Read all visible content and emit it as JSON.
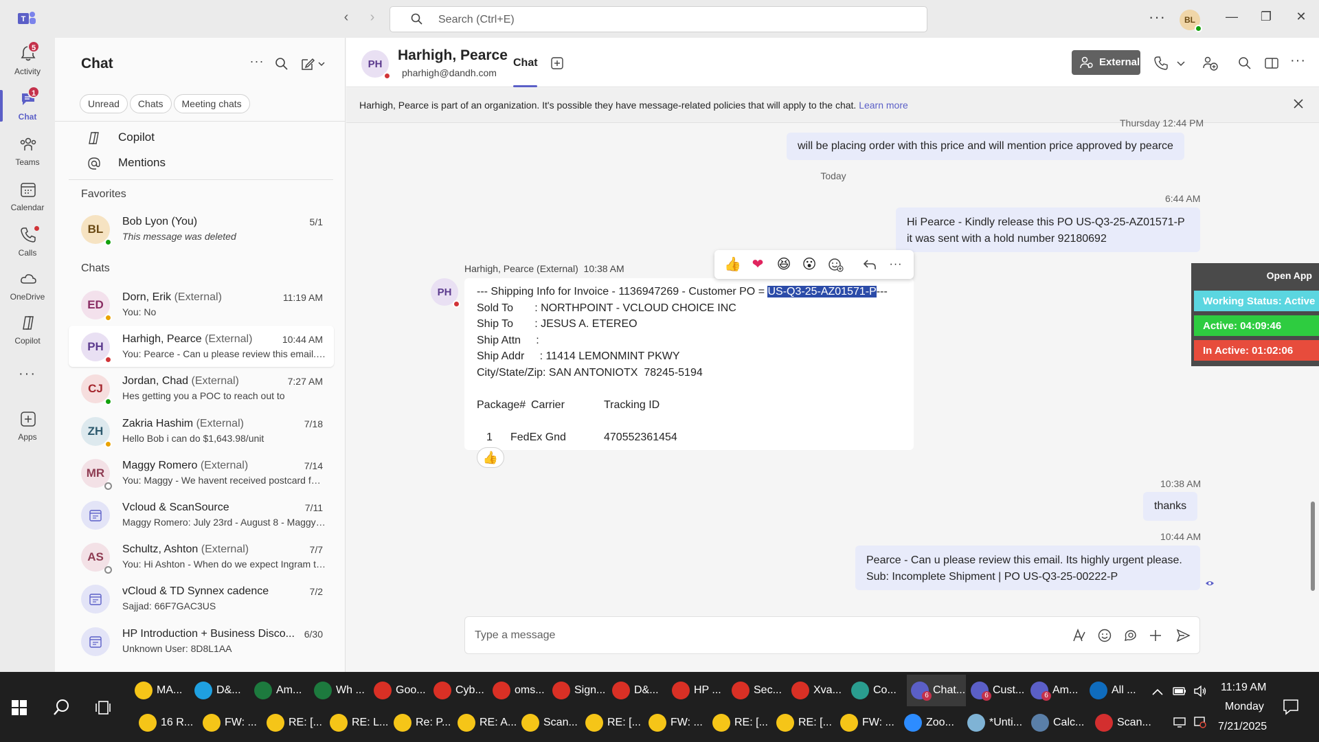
{
  "titlebar": {
    "search_placeholder": "Search (Ctrl+E)",
    "user_initials": "BL",
    "more": "···"
  },
  "rail": [
    {
      "label": "Activity",
      "icon": "bell-icon",
      "badge": "5"
    },
    {
      "label": "Chat",
      "icon": "chat-icon",
      "badge": "1",
      "active": true
    },
    {
      "label": "Teams",
      "icon": "teams-icon"
    },
    {
      "label": "Calendar",
      "icon": "calendar-icon"
    },
    {
      "label": "Calls",
      "icon": "phone-icon"
    },
    {
      "label": "OneDrive",
      "icon": "cloud-icon"
    },
    {
      "label": "Copilot",
      "icon": "copilot-icon"
    },
    {
      "label": "Apps",
      "icon": "apps-icon"
    }
  ],
  "chat_panel": {
    "title": "Chat",
    "filters": [
      "Unread",
      "Chats",
      "Meeting chats"
    ],
    "links": [
      {
        "label": "Copilot",
        "icon": "copilot-icon"
      },
      {
        "label": "Mentions",
        "icon": "at-icon"
      }
    ],
    "favorites_label": "Favorites",
    "favorites": [
      {
        "initials": "BL",
        "name": "Bob Lyon (You)",
        "ext": "",
        "time": "5/1",
        "preview": "This message was deleted",
        "italic": true,
        "presence": "green",
        "avatar_bg": "#f6e3c2",
        "avatar_fg": "#6b4a14"
      }
    ],
    "chats_label": "Chats",
    "chats": [
      {
        "initials": "ED",
        "name": "Dorn, Erik",
        "ext": "(External)",
        "time": "11:19 AM",
        "preview": "You: No",
        "presence": "yellow",
        "avatar_bg": "#f3e1ec",
        "avatar_fg": "#8a2d63"
      },
      {
        "initials": "PH",
        "name": "Harhigh, Pearce",
        "ext": "(External)",
        "time": "10:44 AM",
        "preview": "You: Pearce -  Can u please review this email. It's highly urgent please.",
        "presence": "red",
        "selected": true,
        "avatar_bg": "#e9e0f3",
        "avatar_fg": "#5c3b8e"
      },
      {
        "initials": "CJ",
        "name": "Jordan, Chad",
        "ext": "(External)",
        "time": "7:27 AM",
        "preview": "Hes getting you a POC to reach out to",
        "presence": "green",
        "avatar_bg": "#f6dede",
        "avatar_fg": "#a4262c"
      },
      {
        "initials": "ZH",
        "name": "Zakria Hashim",
        "ext": "(External)",
        "time": "7/18",
        "preview": "Hello Bob i can do $1,643.98/unit",
        "presence": "yellow",
        "avatar_bg": "#dde9ee",
        "avatar_fg": "#2d5a6e"
      },
      {
        "initials": "MR",
        "name": "Maggy Romero",
        "ext": "(External)",
        "time": "7/14",
        "preview": "You: Maggy - We havent received postcard for this one",
        "presence": "gray",
        "avatar_bg": "#f3e1e6",
        "avatar_fg": "#8e3b52"
      },
      {
        "initials": "",
        "name": "Vcloud & ScanSource",
        "ext": "",
        "time": "7/11",
        "preview": "Maggy Romero: July 23rd - August 8 - Maggy Romero",
        "presence": "",
        "meeting": true
      },
      {
        "initials": "AS",
        "name": "Schultz, Ashton",
        "ext": "(External)",
        "time": "7/7",
        "preview": "You: Hi Ashton -  When do we expect Ingram to ship",
        "presence": "gray",
        "avatar_bg": "#f3e1e6",
        "avatar_fg": "#8e3b52"
      },
      {
        "initials": "",
        "name": "vCloud & TD Synnex cadence",
        "ext": "",
        "time": "7/2",
        "preview": "Sajjad: 66F7GAC3US",
        "presence": "",
        "meeting": true
      },
      {
        "initials": "",
        "name": "HP Introduction + Business Disco...",
        "ext": "",
        "time": "6/30",
        "preview": "Unknown User: 8D8L1AA",
        "presence": "",
        "meeting": true
      }
    ]
  },
  "conversation": {
    "initials": "PH",
    "name": "Harhigh, Pearce",
    "email": "pharhigh@dandh.com",
    "tab": "Chat",
    "external_label": "External",
    "banner_text": "Harhigh, Pearce is part of an organization. It's possible they have message-related policies that will apply to the chat.",
    "banner_link": "Learn more",
    "messages": {
      "m1_time": "Thursday 12:44 PM",
      "m1_text": "will be placing order with this price and will mention price approved by pearce",
      "day_divider": "Today",
      "m2_time": "6:44 AM",
      "m2_line1": "Hi Pearce -  Kindly release this PO US-Q3-25-AZ01571-P",
      "m2_line2": "it was sent with a hold number 92180692",
      "m3_sender": "Harhigh, Pearce (External)",
      "m3_time": "10:38 AM",
      "m3_l1_pre": "--- Shipping Info for Invoice - 1136947269 - Customer PO = ",
      "m3_l1_hl": "US-Q3-25-AZ01571-P",
      "m3_l1_post": "---",
      "m3_l2": "Sold To       : NORTHPOINT - VCLOUD CHOICE INC",
      "m3_l3": "Ship To       : JESUS A. ETEREO",
      "m3_l4": "Ship Attn     :",
      "m3_l5": "Ship Addr     : 11414 LEMONMINT PKWY",
      "m3_l6": "City/State/Zip: SAN ANTONIOTX  78245-5194",
      "m3_h1": "Package#",
      "m3_h2": "Carrier",
      "m3_h3": "Tracking ID",
      "m3_r1": "1",
      "m3_r2": "FedEx Gnd",
      "m3_r3": "470552361454",
      "m3_reaction": "👍",
      "m4_time": "10:38 AM",
      "m4_text": "thanks",
      "m5_time": "10:44 AM",
      "m5_line1": "Pearce -  Can u please review this email. Its highly urgent please.",
      "m5_line2": "Sub: Incomplete Shipment | PO US-Q3-25-00222-P"
    },
    "reactions": [
      "👍",
      "❤",
      "😆",
      "😮"
    ],
    "compose_placeholder": "Type a message"
  },
  "side_widget": {
    "title": "Open App",
    "working": "Working Status: Active",
    "active": "Active: 04:09:46",
    "inactive": "In Active: 01:02:06",
    "colors": {
      "working": "#5bd6e0",
      "active": "#2ecc40",
      "inactive": "#e74c3c"
    }
  },
  "taskbar": {
    "row1": [
      {
        "label": "MA...",
        "icon": "folder-icon",
        "color": "#f5c518"
      },
      {
        "label": "D&...",
        "icon": "edge-icon",
        "color": "#1fa0e0"
      },
      {
        "label": "Am...",
        "icon": "excel-icon",
        "color": "#1d7a3e"
      },
      {
        "label": "Wh ...",
        "icon": "excel-icon",
        "color": "#1d7a3e"
      },
      {
        "label": "Goo...",
        "icon": "chrome-icon",
        "color": "#d93025"
      },
      {
        "label": "Cyb...",
        "icon": "chrome-icon",
        "color": "#d93025"
      },
      {
        "label": "oms...",
        "icon": "chrome-icon",
        "color": "#d93025"
      },
      {
        "label": "Sign...",
        "icon": "chrome-icon",
        "color": "#d93025"
      },
      {
        "label": "D&...",
        "icon": "chrome-icon",
        "color": "#d93025"
      },
      {
        "label": "HP ...",
        "icon": "chrome-icon",
        "color": "#d93025"
      },
      {
        "label": "Sec...",
        "icon": "chrome-icon",
        "color": "#d93025"
      },
      {
        "label": "Xva...",
        "icon": "chrome-icon",
        "color": "#d93025"
      },
      {
        "label": "Co...",
        "icon": "app-icon",
        "color": "#2a9d8f"
      },
      {
        "label": "Chat...",
        "icon": "teams-icon",
        "color": "#5b5fc7",
        "badge": "6",
        "active": true
      },
      {
        "label": "Cust...",
        "icon": "teams-icon",
        "color": "#5b5fc7",
        "badge": "6"
      },
      {
        "label": "Am...",
        "icon": "teams-icon",
        "color": "#5b5fc7",
        "badge": "6"
      },
      {
        "label": "All ...",
        "icon": "outlook-icon",
        "color": "#0f6cbd"
      }
    ],
    "row2": [
      {
        "label": "16 R...",
        "icon": "bell-icon",
        "color": "#f5c518"
      },
      {
        "label": "FW: ...",
        "icon": "mail-icon",
        "color": "#f5c518"
      },
      {
        "label": "RE: [...",
        "icon": "mail-icon",
        "color": "#f5c518"
      },
      {
        "label": "RE: L...",
        "icon": "mail-icon",
        "color": "#f5c518"
      },
      {
        "label": "Re: P...",
        "icon": "mail-icon",
        "color": "#f5c518"
      },
      {
        "label": "RE: A...",
        "icon": "mail-icon",
        "color": "#f5c518"
      },
      {
        "label": "Scan...",
        "icon": "mail-icon",
        "color": "#f5c518"
      },
      {
        "label": "RE: [...",
        "icon": "mail-icon",
        "color": "#f5c518"
      },
      {
        "label": "FW: ...",
        "icon": "mail-icon",
        "color": "#f5c518"
      },
      {
        "label": "RE: [...",
        "icon": "mail-icon",
        "color": "#f5c518"
      },
      {
        "label": "RE: [...",
        "icon": "mail-icon",
        "color": "#f5c518"
      },
      {
        "label": "FW: ...",
        "icon": "mail-icon",
        "color": "#f5c518"
      },
      {
        "label": "Zoo...",
        "icon": "zoom-icon",
        "color": "#2d8cff"
      },
      {
        "label": "*Unti...",
        "icon": "notepad-icon",
        "color": "#7fb3d5"
      },
      {
        "label": "Calc...",
        "icon": "calculator-icon",
        "color": "#5a7fa8"
      },
      {
        "label": "Scan...",
        "icon": "pdf-icon",
        "color": "#d32f2f"
      }
    ],
    "zoom_text": "zoom",
    "time": "11:19 AM",
    "day": "Monday",
    "date": "7/21/2025"
  }
}
